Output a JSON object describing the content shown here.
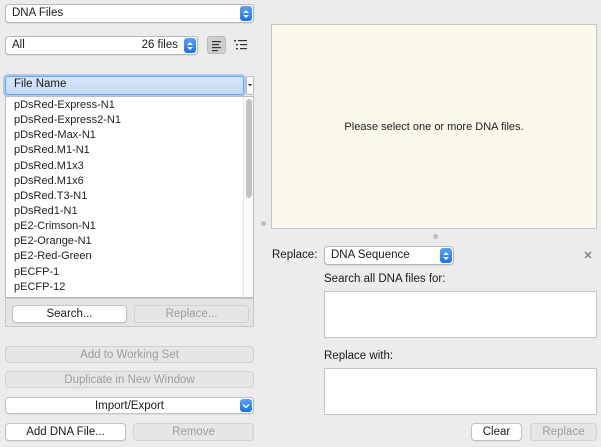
{
  "top_popup": {
    "label": "DNA Files"
  },
  "filter": {
    "label": "All",
    "count": "26 files"
  },
  "list_header": {
    "label": "File Name"
  },
  "files": [
    "pDsRed-Express-N1",
    "pDsRed-Express2-N1",
    "pDsRed-Max-N1",
    "pDsRed.M1-N1",
    "pDsRed.M1x3",
    "pDsRed.M1x6",
    "pDsRed.T3-N1",
    "pDsRed1-N1",
    "pE2-Crimson-N1",
    "pE2-Orange-N1",
    "pE2-Red-Green",
    "pECFP-1",
    "pECFP-12"
  ],
  "list_buttons": {
    "search": "Search...",
    "replace": "Replace..."
  },
  "actions": {
    "add_to_working_set": "Add to Working Set",
    "duplicate": "Duplicate in New Window",
    "import_export": "Import/Export",
    "add_file": "Add DNA File...",
    "remove": "Remove"
  },
  "preview": {
    "message": "Please select one or more DNA files."
  },
  "replace_panel": {
    "label": "Replace:",
    "mode": "DNA Sequence",
    "search_label": "Search all DNA files for:",
    "replace_label": "Replace with:",
    "clear": "Clear",
    "replace": "Replace"
  },
  "colors": {
    "accent": "#1a73e8",
    "preview_bg": "#fdf8ec",
    "window_bg": "#ececec"
  }
}
